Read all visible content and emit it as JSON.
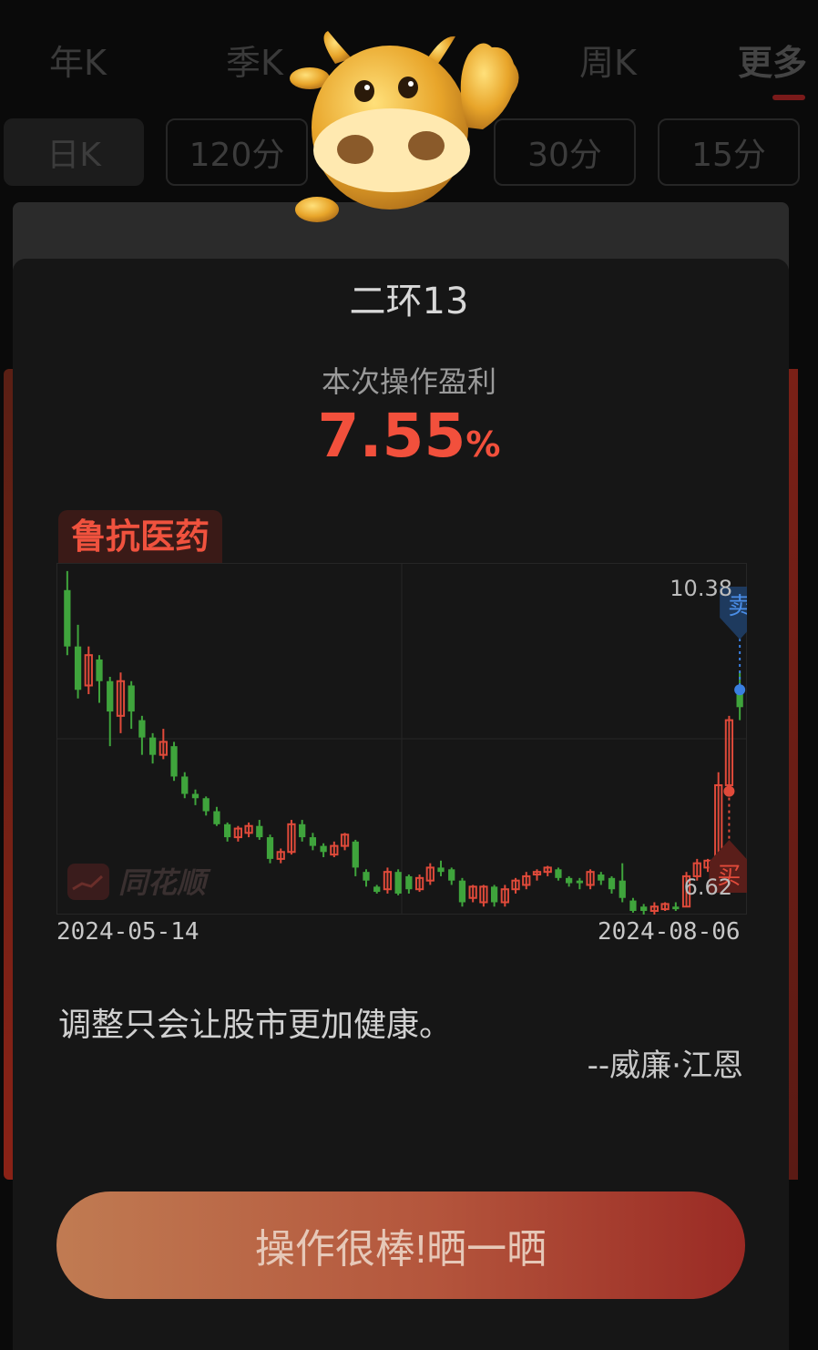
{
  "background": {
    "tabs": [
      "年K",
      "季K",
      "周K",
      "更多"
    ],
    "periods": [
      "日K",
      "120分",
      "30分",
      "15分"
    ]
  },
  "modal": {
    "title": "二环13",
    "profit_label": "本次操作盈利",
    "profit_value": "7.55",
    "profit_unit": "%",
    "stock_name": "鲁抗医药",
    "watermark": "同花顺",
    "date_start": "2024-05-14",
    "date_end": "2024-08-06",
    "quote": "调整只会让股市更加健康。",
    "author": "--威廉·江恩",
    "share_button": "操作很棒!晒一晒",
    "sell_marker": "卖",
    "buy_marker": "买",
    "colors": {
      "up": "#e04a3a",
      "down": "#3fa43c",
      "accent": "#f2503c",
      "sell": "#3a7fe0"
    }
  },
  "chart_data": {
    "type": "candlestick",
    "x_start": "2024-05-14",
    "x_end": "2024-08-06",
    "y_max_label": "10.38",
    "y_min_label": "6.62",
    "ylim": [
      6.5,
      10.45
    ],
    "buy_price": 7.88,
    "sell_price": 9.05,
    "candles": [
      [
        10.2,
        9.55,
        10.42,
        9.45
      ],
      [
        9.55,
        9.05,
        9.8,
        8.95
      ],
      [
        9.1,
        9.45,
        9.55,
        9.0
      ],
      [
        9.4,
        9.15,
        9.45,
        8.9
      ],
      [
        9.15,
        8.8,
        9.2,
        8.4
      ],
      [
        8.75,
        9.15,
        9.25,
        8.55
      ],
      [
        9.1,
        8.8,
        9.15,
        8.6
      ],
      [
        8.7,
        8.5,
        8.75,
        8.3
      ],
      [
        8.5,
        8.3,
        8.55,
        8.2
      ],
      [
        8.3,
        8.45,
        8.6,
        8.25
      ],
      [
        8.4,
        8.05,
        8.45,
        8.0
      ],
      [
        8.05,
        7.85,
        8.1,
        7.8
      ],
      [
        7.85,
        7.8,
        7.9,
        7.72
      ],
      [
        7.8,
        7.65,
        7.82,
        7.6
      ],
      [
        7.65,
        7.5,
        7.7,
        7.48
      ],
      [
        7.5,
        7.35,
        7.52,
        7.3
      ],
      [
        7.35,
        7.45,
        7.48,
        7.3
      ],
      [
        7.4,
        7.48,
        7.52,
        7.35
      ],
      [
        7.48,
        7.35,
        7.55,
        7.32
      ],
      [
        7.35,
        7.1,
        7.38,
        7.05
      ],
      [
        7.1,
        7.18,
        7.22,
        7.05
      ],
      [
        7.18,
        7.5,
        7.55,
        7.15
      ],
      [
        7.5,
        7.35,
        7.55,
        7.3
      ],
      [
        7.35,
        7.25,
        7.4,
        7.2
      ],
      [
        7.25,
        7.18,
        7.28,
        7.12
      ],
      [
        7.15,
        7.25,
        7.3,
        7.12
      ],
      [
        7.25,
        7.38,
        7.4,
        7.2
      ],
      [
        7.3,
        7.0,
        7.32,
        6.9
      ],
      [
        6.95,
        6.85,
        6.98,
        6.78
      ],
      [
        6.78,
        6.72,
        6.8,
        6.7
      ],
      [
        6.75,
        6.95,
        7.0,
        6.7
      ],
      [
        6.95,
        6.7,
        6.98,
        6.68
      ],
      [
        6.9,
        6.75,
        6.92,
        6.7
      ],
      [
        6.75,
        6.88,
        6.92,
        6.72
      ],
      [
        6.85,
        7.0,
        7.05,
        6.8
      ],
      [
        7.0,
        6.95,
        7.08,
        6.9
      ],
      [
        6.98,
        6.85,
        7.0,
        6.8
      ],
      [
        6.85,
        6.6,
        6.88,
        6.55
      ],
      [
        6.65,
        6.78,
        6.8,
        6.6
      ],
      [
        6.6,
        6.78,
        6.8,
        6.55
      ],
      [
        6.78,
        6.6,
        6.8,
        6.55
      ],
      [
        6.6,
        6.75,
        6.8,
        6.55
      ],
      [
        6.75,
        6.85,
        6.88,
        6.7
      ],
      [
        6.8,
        6.9,
        6.95,
        6.75
      ],
      [
        6.92,
        6.95,
        6.98,
        6.85
      ],
      [
        6.95,
        7.0,
        7.02,
        6.9
      ],
      [
        6.98,
        6.88,
        7.0,
        6.85
      ],
      [
        6.88,
        6.82,
        6.9,
        6.78
      ],
      [
        6.85,
        6.82,
        6.88,
        6.75
      ],
      [
        6.8,
        6.95,
        6.98,
        6.75
      ],
      [
        6.92,
        6.85,
        6.95,
        6.8
      ],
      [
        6.88,
        6.75,
        6.9,
        6.7
      ],
      [
        6.85,
        6.65,
        7.05,
        6.6
      ],
      [
        6.62,
        6.5,
        6.65,
        6.48
      ],
      [
        6.55,
        6.5,
        6.58,
        6.45
      ],
      [
        6.5,
        6.55,
        6.6,
        6.45
      ],
      [
        6.52,
        6.58,
        6.6,
        6.5
      ],
      [
        6.55,
        6.52,
        6.6,
        6.5
      ],
      [
        6.55,
        6.9,
        6.95,
        6.55
      ],
      [
        6.9,
        7.05,
        7.1,
        6.85
      ],
      [
        7.0,
        7.08,
        7.1,
        6.95
      ],
      [
        7.05,
        7.95,
        8.1,
        7.0
      ],
      [
        7.95,
        8.7,
        8.75,
        7.9
      ],
      [
        9.1,
        8.85,
        9.25,
        8.7
      ]
    ]
  }
}
